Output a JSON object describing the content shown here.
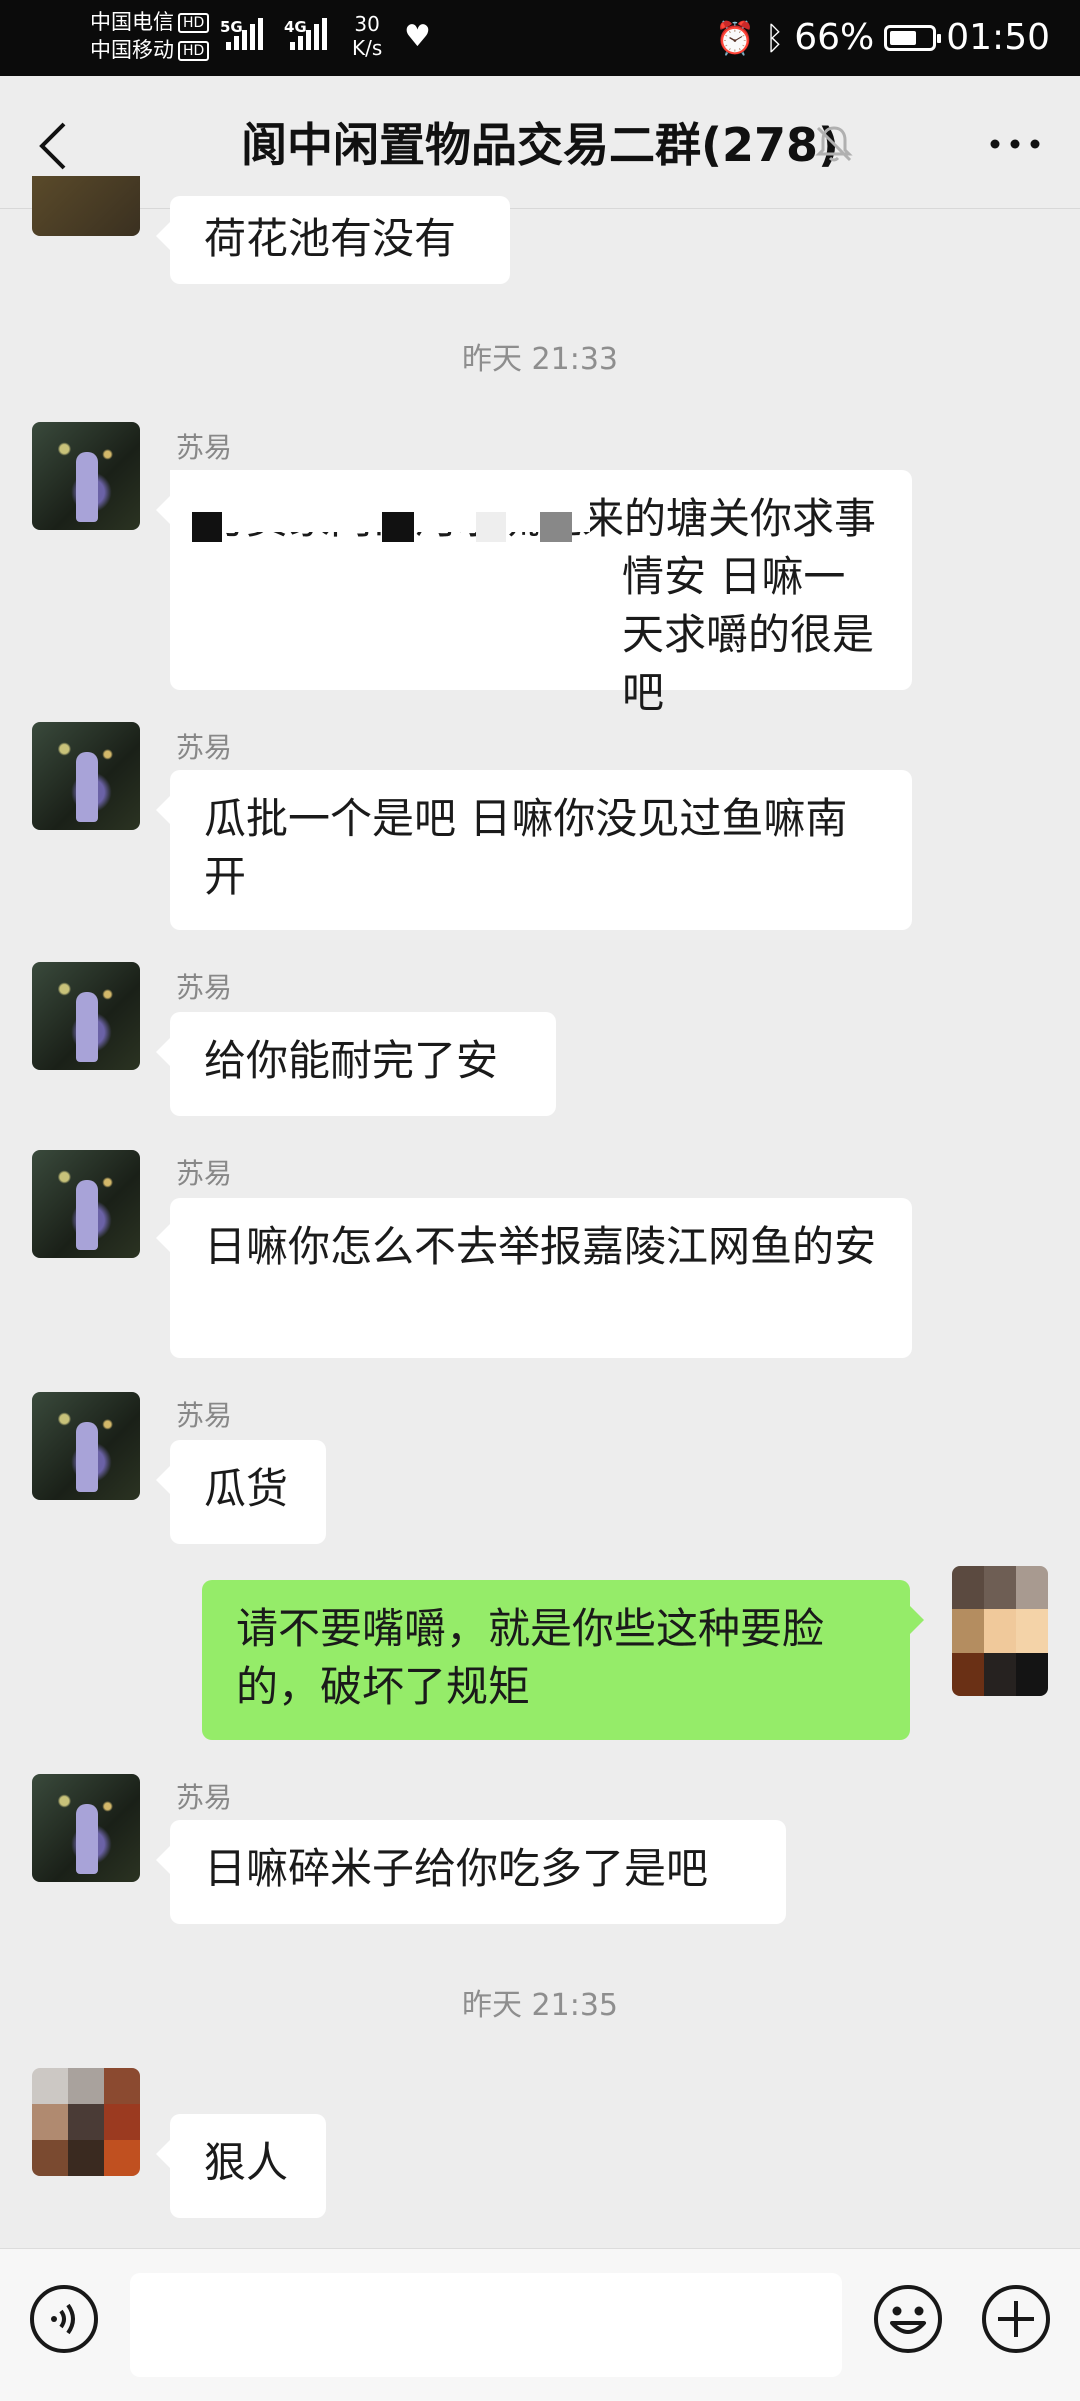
{
  "status_bar": {
    "carrier1": "中国电信",
    "carrier2": "中国移动",
    "hd": "HD",
    "net1": "5G",
    "net2": "4G",
    "speed_value": "30",
    "speed_unit": "K/s",
    "battery_percent": "66%",
    "battery_level": 0.66,
    "time": "01:50"
  },
  "header": {
    "title": "阆中闲置物品交易二群(278)"
  },
  "messages": {
    "m0": {
      "text": "荷花池有没有"
    },
    "t1": "昨天 21:33",
    "m1": {
      "sender": "苏易",
      "text": "劳资家门口河水流进来的塘关你求事情安 日嘛一天求嚼的很是吧"
    },
    "m2": {
      "sender": "苏易",
      "text": "瓜批一个是吧 日嘛你没见过鱼嘛南开"
    },
    "m3": {
      "sender": "苏易",
      "text": "给你能耐完了安"
    },
    "m4": {
      "sender": "苏易",
      "text": "日嘛你怎么不去举报嘉陵江网鱼的安"
    },
    "m5": {
      "sender": "苏易",
      "text": "瓜货"
    },
    "m6": {
      "text": "请不要嘴嚼，就是你些这种要脸的，破坏了规矩"
    },
    "m7": {
      "sender": "苏易",
      "text": "日嘛碎米子给你吃多了是吧"
    },
    "t2": "昨天 21:35",
    "m8": {
      "text": "狠人"
    }
  },
  "colors": {
    "background": "#ededed",
    "bubble_incoming": "#ffffff",
    "bubble_outgoing": "#95ec69",
    "timestamp": "#8e8e8e"
  },
  "icons": {
    "back": "back-chevron-icon",
    "mute": "bell-muted-icon",
    "more": "more-dots-icon",
    "voice": "voice-icon",
    "emoji": "emoji-icon",
    "add": "plus-icon"
  }
}
